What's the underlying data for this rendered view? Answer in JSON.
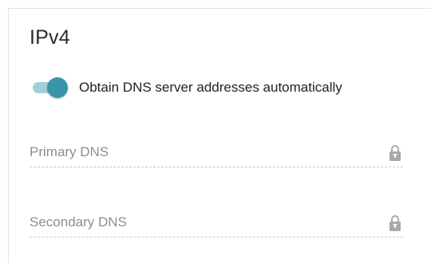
{
  "section": {
    "title": "IPv4"
  },
  "dns_toggle": {
    "label": "Obtain DNS server addresses automatically",
    "state": "on",
    "accent_color": "#3c94ab"
  },
  "fields": {
    "primary_dns": {
      "placeholder": "Primary DNS",
      "value": "",
      "icon": "lock-icon"
    },
    "secondary_dns": {
      "placeholder": "Secondary DNS",
      "value": "",
      "icon": "lock-icon"
    }
  }
}
